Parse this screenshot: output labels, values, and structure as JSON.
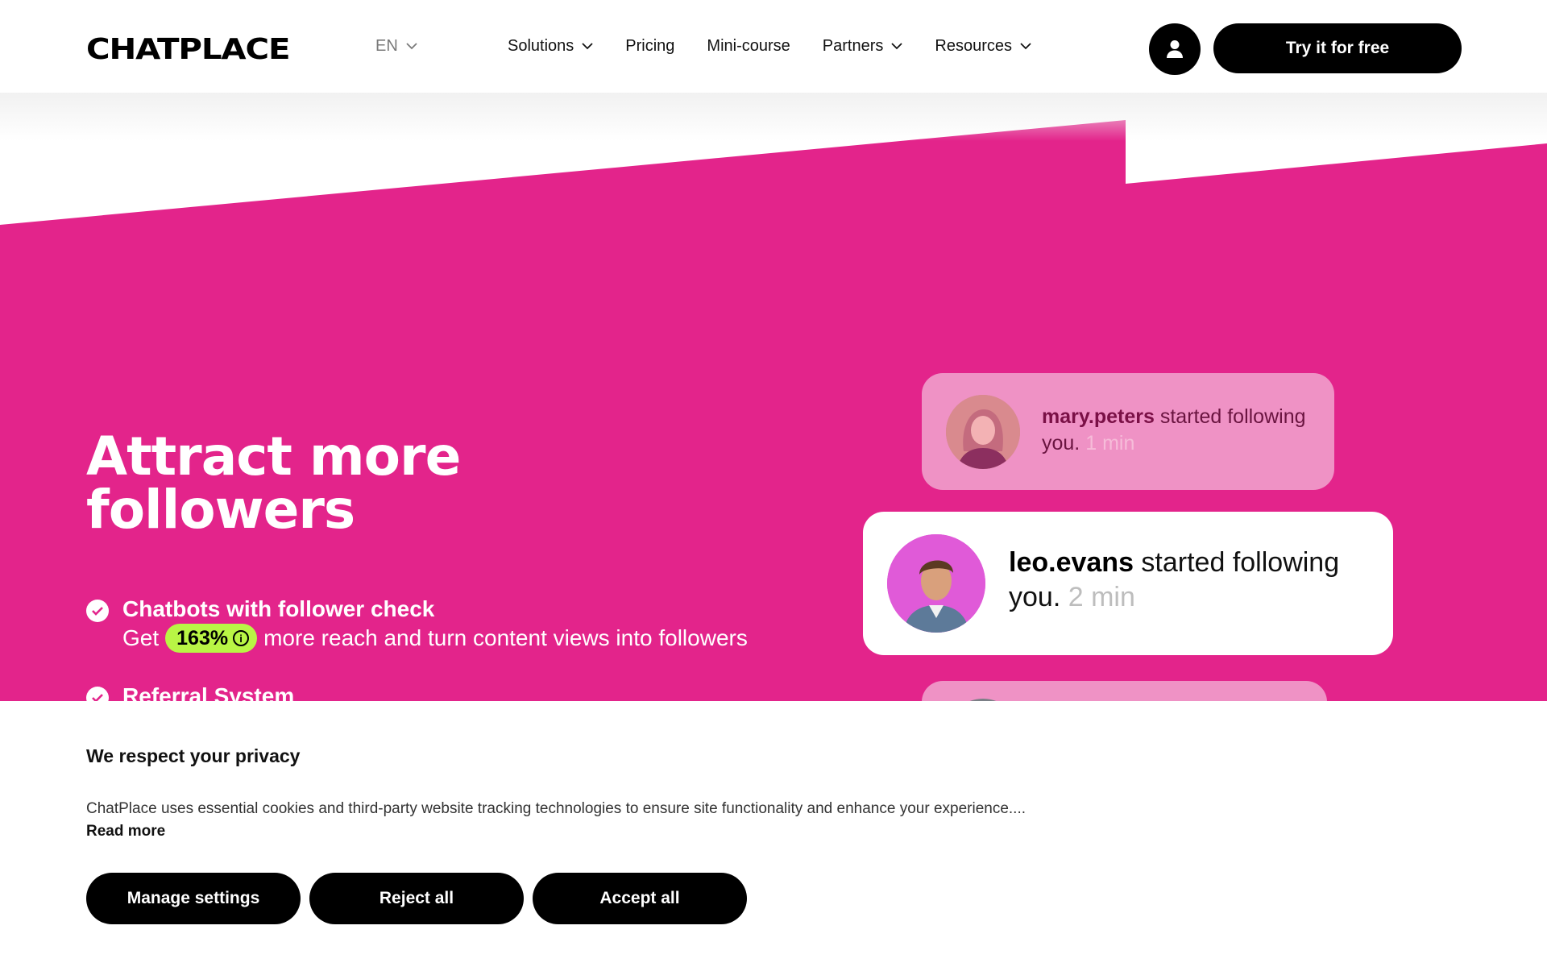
{
  "header": {
    "logo": "CHATPLACE",
    "language": "EN",
    "nav": [
      {
        "label": "Solutions",
        "dropdown": true
      },
      {
        "label": "Pricing",
        "dropdown": false
      },
      {
        "label": "Mini-course",
        "dropdown": false
      },
      {
        "label": "Partners",
        "dropdown": true
      },
      {
        "label": "Resources",
        "dropdown": true
      }
    ],
    "user_icon": "user-icon",
    "cta_label": "Try it for free"
  },
  "hero": {
    "title": "Attract more followers",
    "features": [
      {
        "title": "Chatbots with follower check",
        "desc_before": "Get",
        "badge": "163%",
        "desc_after": "more reach and turn content views into followers"
      },
      {
        "title": "Referral System"
      }
    ],
    "notifications": [
      {
        "user": "mary.peters",
        "text": " started following you.",
        "time": "1 min"
      },
      {
        "user": "leo.evans",
        "text": " started following you.",
        "time": "2 min"
      }
    ]
  },
  "cookie": {
    "title": "We respect your privacy",
    "text": "ChatPlace uses essential cookies and third-party website tracking technologies to ensure site functionality and enhance your experience....",
    "read_more": "Read more",
    "buttons": {
      "manage": "Manage settings",
      "reject": "Reject all",
      "accept": "Accept all"
    }
  },
  "colors": {
    "brand_pink": "#e3248b",
    "card_faded": "#ef92c5",
    "badge_lime": "#b9f545",
    "black": "#000000"
  }
}
